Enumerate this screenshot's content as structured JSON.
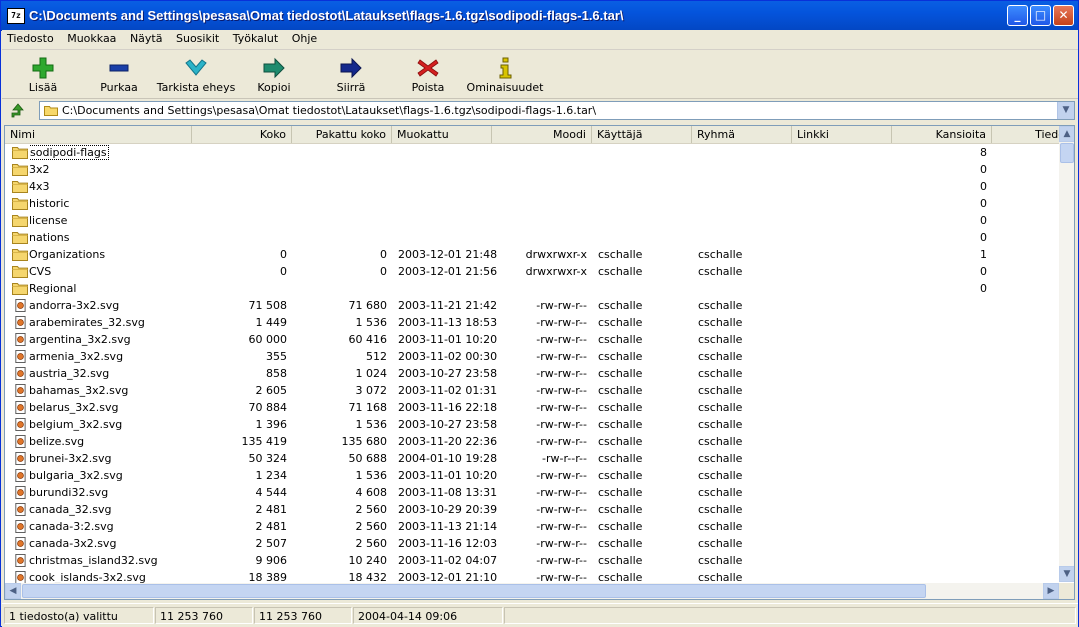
{
  "window": {
    "title": "C:\\Documents and Settings\\pesasa\\Omat tiedostot\\Lataukset\\flags-1.6.tgz\\sodipodi-flags-1.6.tar\\",
    "app_icon_text": "7z"
  },
  "menu": [
    "Tiedosto",
    "Muokkaa",
    "Näytä",
    "Suosikit",
    "Työkalut",
    "Ohje"
  ],
  "toolbar": [
    {
      "label": "Lisää",
      "icon": "add-icon",
      "color": "#2ea82e"
    },
    {
      "label": "Purkaa",
      "icon": "extract-icon",
      "color": "#1a3fa8"
    },
    {
      "label": "Tarkista eheys",
      "icon": "test-icon",
      "color": "#2bb3c8"
    },
    {
      "label": "Kopioi",
      "icon": "copy-icon",
      "color": "#1e8b6e"
    },
    {
      "label": "Siirrä",
      "icon": "move-icon",
      "color": "#14288c"
    },
    {
      "label": "Poista",
      "icon": "delete-icon",
      "color": "#d42020"
    },
    {
      "label": "Ominaisuudet",
      "icon": "info-icon",
      "color": "#d8c400"
    }
  ],
  "address": {
    "path": "C:\\Documents and Settings\\pesasa\\Omat tiedostot\\Lataukset\\flags-1.6.tgz\\sodipodi-flags-1.6.tar\\"
  },
  "columns": [
    "Nimi",
    "Koko",
    "Pakattu koko",
    "Muokattu",
    "Moodi",
    "Käyttäjä",
    "Ryhmä",
    "Linkki",
    "Kansioita",
    "Tiedo"
  ],
  "rows": [
    {
      "type": "folder",
      "name": "sodipodi-flags",
      "size": "",
      "packed": "",
      "modified": "",
      "mode": "",
      "user": "",
      "group": "",
      "link": "",
      "folders": "8",
      "selected": true
    },
    {
      "type": "folder",
      "name": "3x2",
      "size": "",
      "packed": "",
      "modified": "",
      "mode": "",
      "user": "",
      "group": "",
      "link": "",
      "folders": "0"
    },
    {
      "type": "folder",
      "name": "4x3",
      "size": "",
      "packed": "",
      "modified": "",
      "mode": "",
      "user": "",
      "group": "",
      "link": "",
      "folders": "0"
    },
    {
      "type": "folder",
      "name": "historic",
      "size": "",
      "packed": "",
      "modified": "",
      "mode": "",
      "user": "",
      "group": "",
      "link": "",
      "folders": "0"
    },
    {
      "type": "folder",
      "name": "license",
      "size": "",
      "packed": "",
      "modified": "",
      "mode": "",
      "user": "",
      "group": "",
      "link": "",
      "folders": "0"
    },
    {
      "type": "folder",
      "name": "nations",
      "size": "",
      "packed": "",
      "modified": "",
      "mode": "",
      "user": "",
      "group": "",
      "link": "",
      "folders": "0"
    },
    {
      "type": "folder",
      "name": "Organizations",
      "size": "0",
      "packed": "0",
      "modified": "2003-12-01 21:48",
      "mode": "drwxrwxr-x",
      "user": "cschalle",
      "group": "cschalle",
      "link": "",
      "folders": "1"
    },
    {
      "type": "folder",
      "name": "CVS",
      "size": "0",
      "packed": "0",
      "modified": "2003-12-01 21:56",
      "mode": "drwxrwxr-x",
      "user": "cschalle",
      "group": "cschalle",
      "link": "",
      "folders": "0"
    },
    {
      "type": "folder",
      "name": "Regional",
      "size": "",
      "packed": "",
      "modified": "",
      "mode": "",
      "user": "",
      "group": "",
      "link": "",
      "folders": "0"
    },
    {
      "type": "file",
      "name": "andorra-3x2.svg",
      "size": "71 508",
      "packed": "71 680",
      "modified": "2003-11-21 21:42",
      "mode": "-rw-rw-r--",
      "user": "cschalle",
      "group": "cschalle",
      "link": "",
      "folders": ""
    },
    {
      "type": "file",
      "name": "arabemirates_32.svg",
      "size": "1 449",
      "packed": "1 536",
      "modified": "2003-11-13 18:53",
      "mode": "-rw-rw-r--",
      "user": "cschalle",
      "group": "cschalle",
      "link": "",
      "folders": ""
    },
    {
      "type": "file",
      "name": "argentina_3x2.svg",
      "size": "60 000",
      "packed": "60 416",
      "modified": "2003-11-01 10:20",
      "mode": "-rw-rw-r--",
      "user": "cschalle",
      "group": "cschalle",
      "link": "",
      "folders": ""
    },
    {
      "type": "file",
      "name": "armenia_3x2.svg",
      "size": "355",
      "packed": "512",
      "modified": "2003-11-02 00:30",
      "mode": "-rw-rw-r--",
      "user": "cschalle",
      "group": "cschalle",
      "link": "",
      "folders": ""
    },
    {
      "type": "file",
      "name": "austria_32.svg",
      "size": "858",
      "packed": "1 024",
      "modified": "2003-10-27 23:58",
      "mode": "-rw-rw-r--",
      "user": "cschalle",
      "group": "cschalle",
      "link": "",
      "folders": ""
    },
    {
      "type": "file",
      "name": "bahamas_3x2.svg",
      "size": "2 605",
      "packed": "3 072",
      "modified": "2003-11-02 01:31",
      "mode": "-rw-rw-r--",
      "user": "cschalle",
      "group": "cschalle",
      "link": "",
      "folders": ""
    },
    {
      "type": "file",
      "name": "belarus_3x2.svg",
      "size": "70 884",
      "packed": "71 168",
      "modified": "2003-11-16 22:18",
      "mode": "-rw-rw-r--",
      "user": "cschalle",
      "group": "cschalle",
      "link": "",
      "folders": ""
    },
    {
      "type": "file",
      "name": "belgium_3x2.svg",
      "size": "1 396",
      "packed": "1 536",
      "modified": "2003-10-27 23:58",
      "mode": "-rw-rw-r--",
      "user": "cschalle",
      "group": "cschalle",
      "link": "",
      "folders": ""
    },
    {
      "type": "file",
      "name": "belize.svg",
      "size": "135 419",
      "packed": "135 680",
      "modified": "2003-11-20 22:36",
      "mode": "-rw-rw-r--",
      "user": "cschalle",
      "group": "cschalle",
      "link": "",
      "folders": ""
    },
    {
      "type": "file",
      "name": "brunei-3x2.svg",
      "size": "50 324",
      "packed": "50 688",
      "modified": "2004-01-10 19:28",
      "mode": "-rw-r--r--",
      "user": "cschalle",
      "group": "cschalle",
      "link": "",
      "folders": ""
    },
    {
      "type": "file",
      "name": "bulgaria_3x2.svg",
      "size": "1 234",
      "packed": "1 536",
      "modified": "2003-11-01 10:20",
      "mode": "-rw-rw-r--",
      "user": "cschalle",
      "group": "cschalle",
      "link": "",
      "folders": ""
    },
    {
      "type": "file",
      "name": "burundi32.svg",
      "size": "4 544",
      "packed": "4 608",
      "modified": "2003-11-08 13:31",
      "mode": "-rw-rw-r--",
      "user": "cschalle",
      "group": "cschalle",
      "link": "",
      "folders": ""
    },
    {
      "type": "file",
      "name": "canada_32.svg",
      "size": "2 481",
      "packed": "2 560",
      "modified": "2003-10-29 20:39",
      "mode": "-rw-rw-r--",
      "user": "cschalle",
      "group": "cschalle",
      "link": "",
      "folders": ""
    },
    {
      "type": "file",
      "name": "canada-3:2.svg",
      "size": "2 481",
      "packed": "2 560",
      "modified": "2003-11-13 21:14",
      "mode": "-rw-rw-r--",
      "user": "cschalle",
      "group": "cschalle",
      "link": "",
      "folders": ""
    },
    {
      "type": "file",
      "name": "canada-3x2.svg",
      "size": "2 507",
      "packed": "2 560",
      "modified": "2003-11-16 12:03",
      "mode": "-rw-rw-r--",
      "user": "cschalle",
      "group": "cschalle",
      "link": "",
      "folders": ""
    },
    {
      "type": "file",
      "name": "christmas_island32.svg",
      "size": "9 906",
      "packed": "10 240",
      "modified": "2003-11-02 04:07",
      "mode": "-rw-rw-r--",
      "user": "cschalle",
      "group": "cschalle",
      "link": "",
      "folders": ""
    },
    {
      "type": "file",
      "name": "cook_islands-3x2.svg",
      "size": "18 389",
      "packed": "18 432",
      "modified": "2003-12-01 21:10",
      "mode": "-rw-rw-r--",
      "user": "cschalle",
      "group": "cschalle",
      "link": "",
      "folders": ""
    }
  ],
  "status": {
    "selection": "1 tiedosto(a) valittu",
    "size": "11 253 760",
    "packed": "11 253 760",
    "modified": "2004-04-14 09:06"
  }
}
